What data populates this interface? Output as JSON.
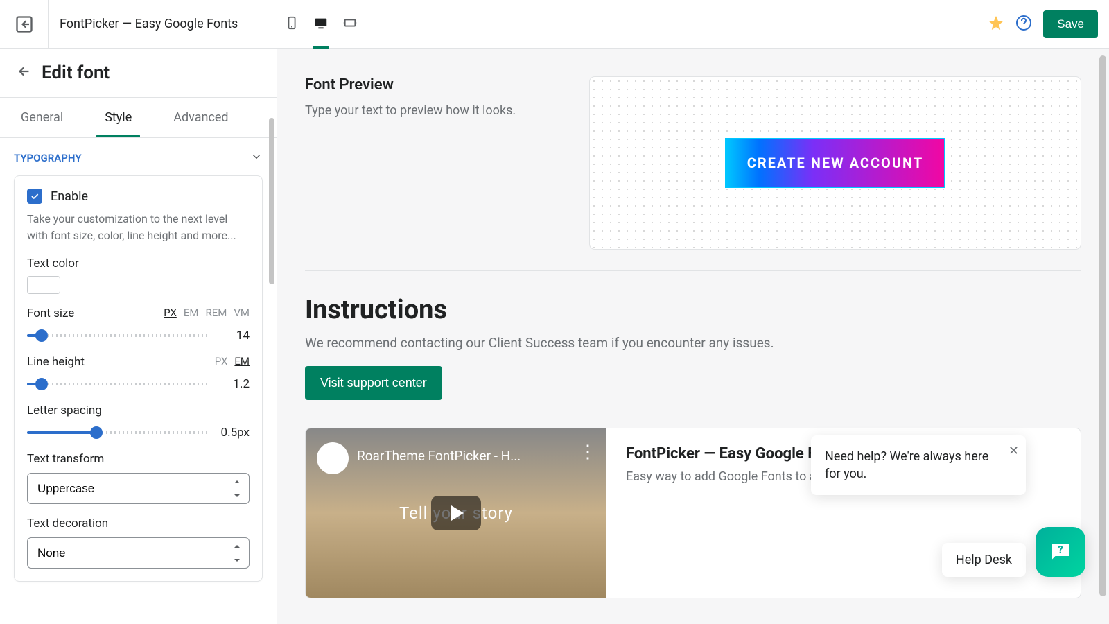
{
  "header": {
    "appTitle": "FontPicker — Easy Google Fonts",
    "saveLabel": "Save"
  },
  "sidebar": {
    "title": "Edit font",
    "tabs": {
      "general": "General",
      "style": "Style",
      "advanced": "Advanced"
    },
    "typography": {
      "sectionLabel": "TYPOGRAPHY",
      "enableLabel": "Enable",
      "helpText": "Take your customization to the next level with font size, color, line height and more...",
      "textColorLabel": "Text color",
      "fontSize": {
        "label": "Font size",
        "value": "14",
        "units": {
          "px": "PX",
          "em": "EM",
          "rem": "REM",
          "vm": "VM"
        },
        "activeUnit": "px",
        "fillPercent": 8
      },
      "lineHeight": {
        "label": "Line height",
        "value": "1.2",
        "units": {
          "px": "PX",
          "em": "EM"
        },
        "activeUnit": "em",
        "fillPercent": 8
      },
      "letterSpacing": {
        "label": "Letter spacing",
        "value": "0.5px",
        "fillPercent": 38
      },
      "textTransform": {
        "label": "Text transform",
        "value": "Uppercase"
      },
      "textDecoration": {
        "label": "Text decoration",
        "value": "None"
      }
    }
  },
  "preview": {
    "title": "Font Preview",
    "sub": "Type your text to preview how it looks.",
    "ctaText": "CREATE NEW ACCOUNT"
  },
  "instructions": {
    "title": "Instructions",
    "sub": "We recommend contacting our Client Success team if you encounter any issues.",
    "supportBtn": "Visit support center"
  },
  "video": {
    "thumbTitle": "RoarTheme FontPicker - H...",
    "thumbCaption": "Tell your story",
    "name": "FontPicker — Easy Google Fonts",
    "desc": "Easy way to add Google Fonts to any Sho"
  },
  "chat": {
    "bubble": "Need help? We're always here for you.",
    "helpDesk": "Help Desk"
  }
}
